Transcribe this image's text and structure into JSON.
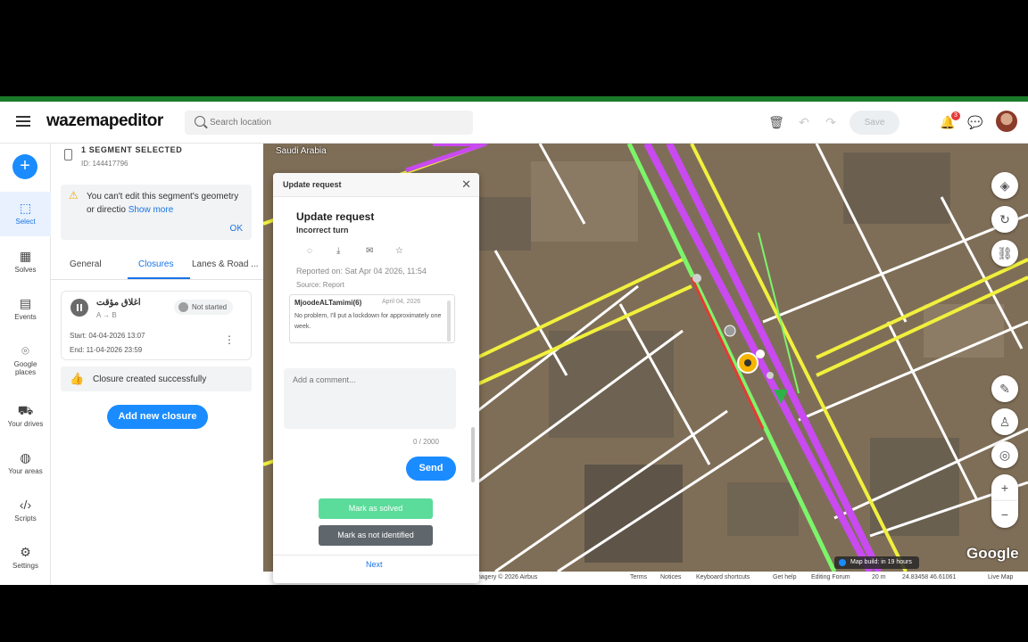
{
  "app": {
    "logo": "wazemapeditor",
    "search_placeholder": "Search location",
    "save_label": "Save",
    "notification_count": "3"
  },
  "rail": {
    "items": [
      {
        "label": "Select",
        "icon": "select-icon"
      },
      {
        "label": "Solves",
        "icon": "solves-icon"
      },
      {
        "label": "Events",
        "icon": "calendar-icon"
      },
      {
        "label": "Google places",
        "icon": "map-pin-icon"
      },
      {
        "label": "Your drives",
        "icon": "car-icon"
      },
      {
        "label": "Your areas",
        "icon": "globe-icon"
      },
      {
        "label": "Scripts",
        "icon": "code-icon"
      },
      {
        "label": "Settings",
        "icon": "gear-icon"
      }
    ]
  },
  "panel": {
    "segment_title": "1 SEGMENT SELECTED",
    "segment_id": "ID: 144417796",
    "warning_text": "You can't edit this segment's geometry or directio",
    "warning_link": "Show more",
    "warning_ok": "OK",
    "tabs": [
      "General",
      "Closures",
      "Lanes & Road ..."
    ],
    "closure": {
      "name": "اغلاق مؤقت",
      "direction": "A → B",
      "status": "Not started",
      "start": "Start: 04-04-2026 13:07",
      "end": "End: 11-04-2026 23:59"
    },
    "toast": "Closure created successfully",
    "add_closure": "Add new closure"
  },
  "dialog": {
    "header": "Update request",
    "title": "Update request",
    "subtitle": "Incorrect turn",
    "reported": "Reported on: Sat Apr 04 2026, 11:54",
    "source": "Source: Report",
    "comment_user": "MjoodeALTamimi(6)",
    "comment_date": "April 04, 2026",
    "comment_text": "No problem, I'll put a lockdown for approximately one week.",
    "input_placeholder": "Add a comment...",
    "char_count": "0 / 2000",
    "send": "Send",
    "mark_solved": "Mark as solved",
    "mark_not_identified": "Mark as not identified",
    "next": "Next"
  },
  "map": {
    "country": "Saudi Arabia",
    "google": "Google",
    "map_build": "Map build: in 19 hours",
    "footer": {
      "imagery": "Imagery © 2026 Airbus",
      "terms": "Terms",
      "notices": "Notices",
      "shortcuts": "Keyboard shortcuts",
      "help": "Get help",
      "forum": "Editing Forum",
      "scale": "20 m",
      "coords": "24.83458 46.61061",
      "live_map": "Live Map"
    }
  },
  "colors": {
    "accent": "#1a8cff",
    "top_border": "#1a7a2a",
    "road_primary": "#c84af0",
    "road_highway_edge": "#7cf56a",
    "road_yellow": "#f1f03d",
    "road_white": "#ffffff"
  }
}
